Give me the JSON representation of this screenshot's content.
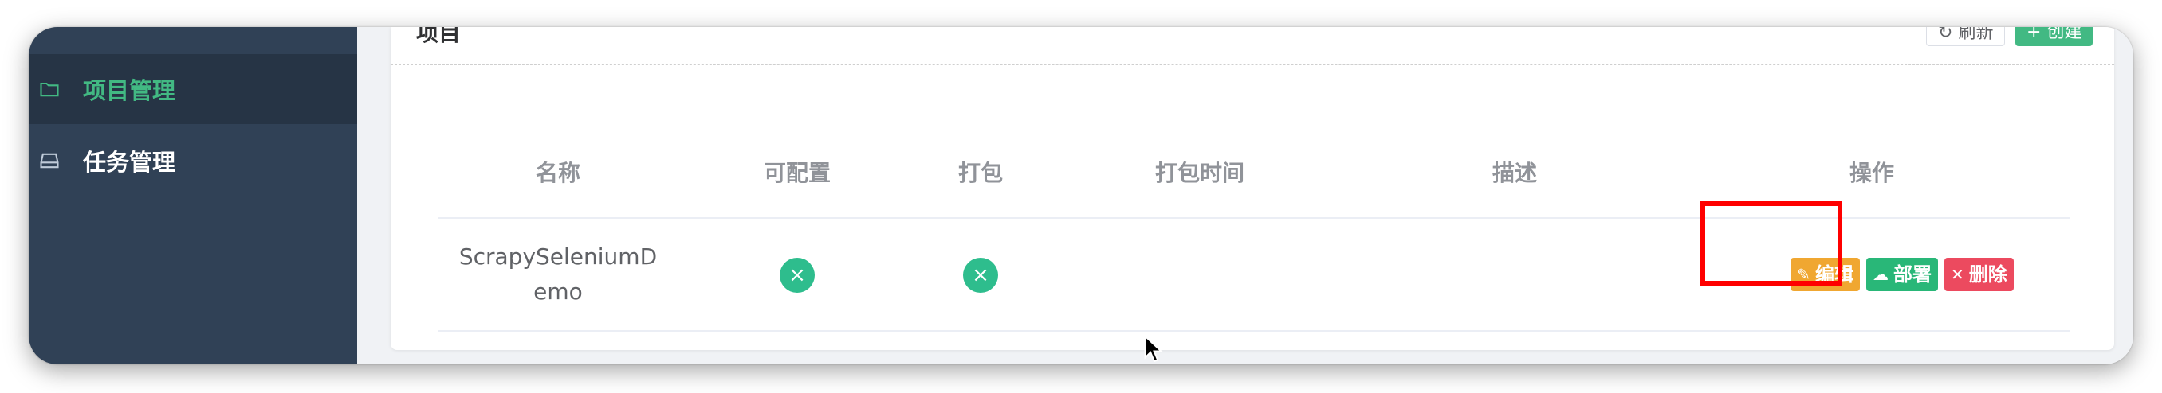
{
  "sidebar": {
    "items": [
      {
        "label": "项目管理",
        "icon": "folder-icon",
        "active": true
      },
      {
        "label": "任务管理",
        "icon": "drive-icon",
        "active": false
      }
    ]
  },
  "card": {
    "title": "项目",
    "refresh_label": "刷新",
    "create_label": "创建"
  },
  "table": {
    "columns": [
      "名称",
      "可配置",
      "打包",
      "打包时间",
      "描述",
      "操作"
    ],
    "rows": [
      {
        "name": "ScrapySeleniumDemo",
        "configurable": "×",
        "packaged": "×",
        "packaged_time": "",
        "description": ""
      }
    ],
    "actions": {
      "edit": "编辑",
      "deploy": "部署",
      "delete": "删除"
    }
  },
  "colors": {
    "sidebar_bg": "#304156",
    "accent_green": "#42b983",
    "edit": "#f0a731",
    "deploy": "#29b778",
    "delete": "#ec4a5f",
    "highlight": "#ff0000"
  }
}
